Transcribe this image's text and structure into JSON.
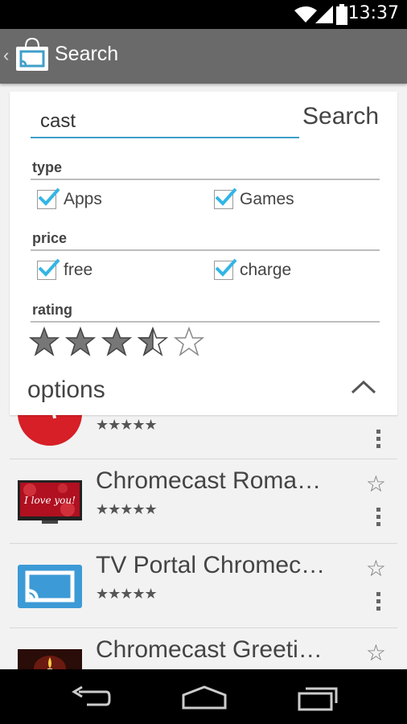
{
  "status": {
    "time": "13:37"
  },
  "action_bar": {
    "title": "Search"
  },
  "search": {
    "value": "cast",
    "button": "Search"
  },
  "filters": {
    "type_label": "type",
    "type_options": [
      {
        "label": "Apps",
        "checked": true
      },
      {
        "label": "Games",
        "checked": true
      }
    ],
    "price_label": "price",
    "price_options": [
      {
        "label": "free",
        "checked": true
      },
      {
        "label": "charge",
        "checked": true
      }
    ],
    "rating_label": "rating",
    "rating_value": 3.5,
    "rating_max": 5,
    "options_label": "options"
  },
  "results": [
    {
      "name": "",
      "stars": "★★★★★"
    },
    {
      "name": "Chromecast Roma…",
      "stars": "★★★★★"
    },
    {
      "name": "TV Portal Chromec…",
      "stars": "★★★★★"
    },
    {
      "name": "Chromecast Greeti…",
      "stars": ""
    }
  ],
  "colors": {
    "accent": "#3f9fc9",
    "action_bar": "#6a6a6a",
    "check": "#33b5e5"
  }
}
